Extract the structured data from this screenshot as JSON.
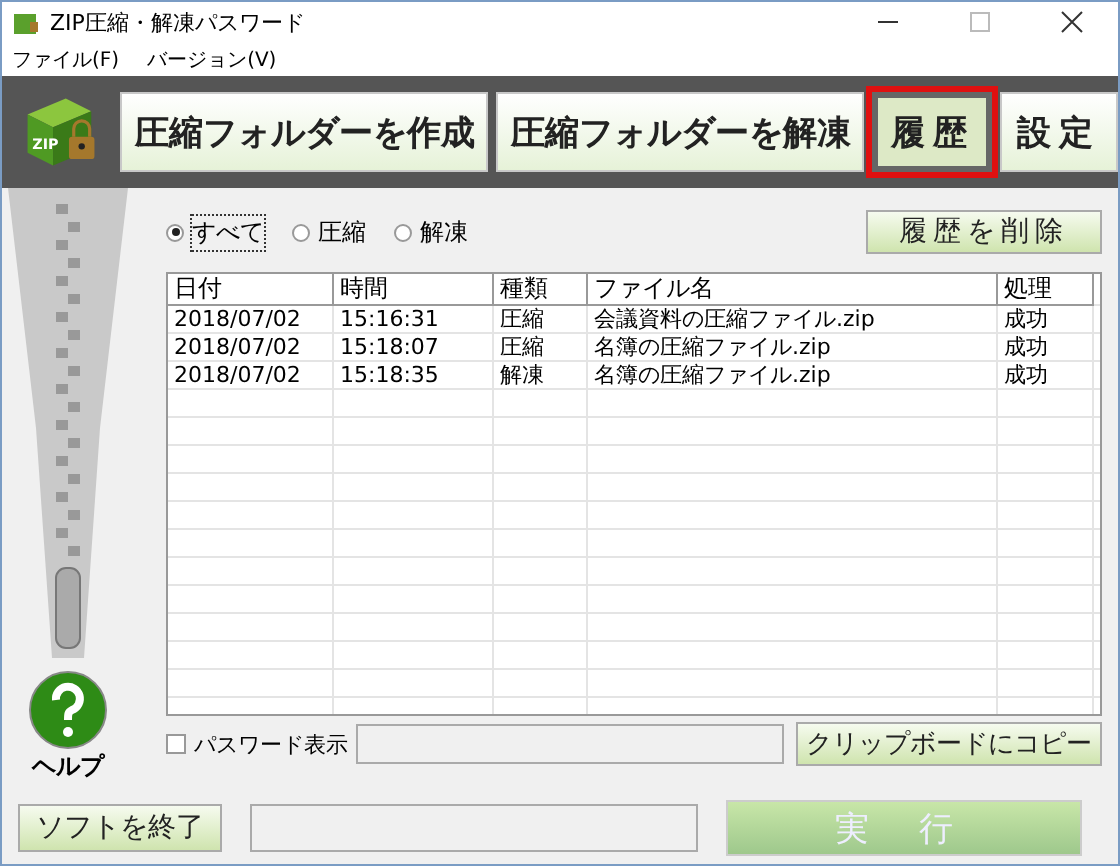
{
  "window": {
    "title": "ZIP圧縮・解凍パスワード"
  },
  "logo_text": "ZIP",
  "menu": [
    "ファイル(F)",
    "バージョン(V)"
  ],
  "tabs": [
    {
      "label": "圧縮フォルダーを作成",
      "selected": false
    },
    {
      "label": "圧縮フォルダーを解凍",
      "selected": false
    },
    {
      "label": "履歴",
      "selected": true
    },
    {
      "label": "設定",
      "selected": false
    }
  ],
  "filters": [
    {
      "label": "すべて",
      "selected": true
    },
    {
      "label": "圧縮",
      "selected": false
    },
    {
      "label": "解凍",
      "selected": false
    }
  ],
  "delete_button": "履歴を削除",
  "table": {
    "columns": [
      "日付",
      "時間",
      "種類",
      "ファイル名",
      "処理"
    ],
    "rows": [
      [
        "2018/07/02",
        "15:16:31",
        "圧縮",
        "会議資料の圧縮ファイル.zip",
        "成功"
      ],
      [
        "2018/07/02",
        "15:18:07",
        "圧縮",
        "名簿の圧縮ファイル.zip",
        "成功"
      ],
      [
        "2018/07/02",
        "15:18:35",
        "解凍",
        "名簿の圧縮ファイル.zip",
        "成功"
      ]
    ]
  },
  "help": "ヘルプ",
  "password": {
    "label": "パスワード表示",
    "checked": false
  },
  "copy_button": "クリップボードにコピー",
  "exit_button": "ソフトを終了",
  "run_button": {
    "label": "実 行",
    "disabled": true
  }
}
